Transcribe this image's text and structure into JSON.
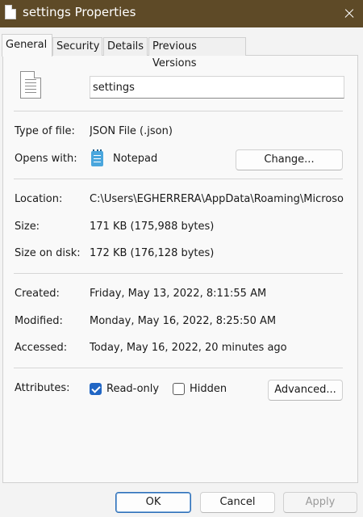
{
  "window": {
    "title": "settings Properties"
  },
  "tabs": [
    {
      "label": "General",
      "active": true
    },
    {
      "label": "Security"
    },
    {
      "label": "Details"
    },
    {
      "label": "Previous Versions"
    }
  ],
  "file": {
    "name": "settings"
  },
  "type": {
    "label": "Type of file:",
    "value": "JSON File (.json)"
  },
  "opens": {
    "label": "Opens with:",
    "value": "Notepad",
    "icon": "notepad-icon",
    "change_label": "Change..."
  },
  "location": {
    "label": "Location:",
    "value": "C:\\Users\\EGHERRERA\\AppData\\Roaming\\Microso"
  },
  "size": {
    "label": "Size:",
    "value": "171 KB (175,988 bytes)"
  },
  "size_on_disk": {
    "label": "Size on disk:",
    "value": "172 KB (176,128 bytes)"
  },
  "created": {
    "label": "Created:",
    "value": "Friday, May 13, 2022, 8:11:55 AM"
  },
  "modified": {
    "label": "Modified:",
    "value": "Monday, May 16, 2022, 8:25:50 AM"
  },
  "accessed": {
    "label": "Accessed:",
    "value": "Today, May 16, 2022, 20 minutes ago"
  },
  "attributes": {
    "label": "Attributes:",
    "readonly_label": "Read-only",
    "readonly_checked": true,
    "hidden_label": "Hidden",
    "hidden_checked": false,
    "advanced_label": "Advanced..."
  },
  "footer": {
    "ok": "OK",
    "cancel": "Cancel",
    "apply": "Apply"
  },
  "colors": {
    "titlebar": "#5e4a27",
    "accent": "#2166c4"
  }
}
